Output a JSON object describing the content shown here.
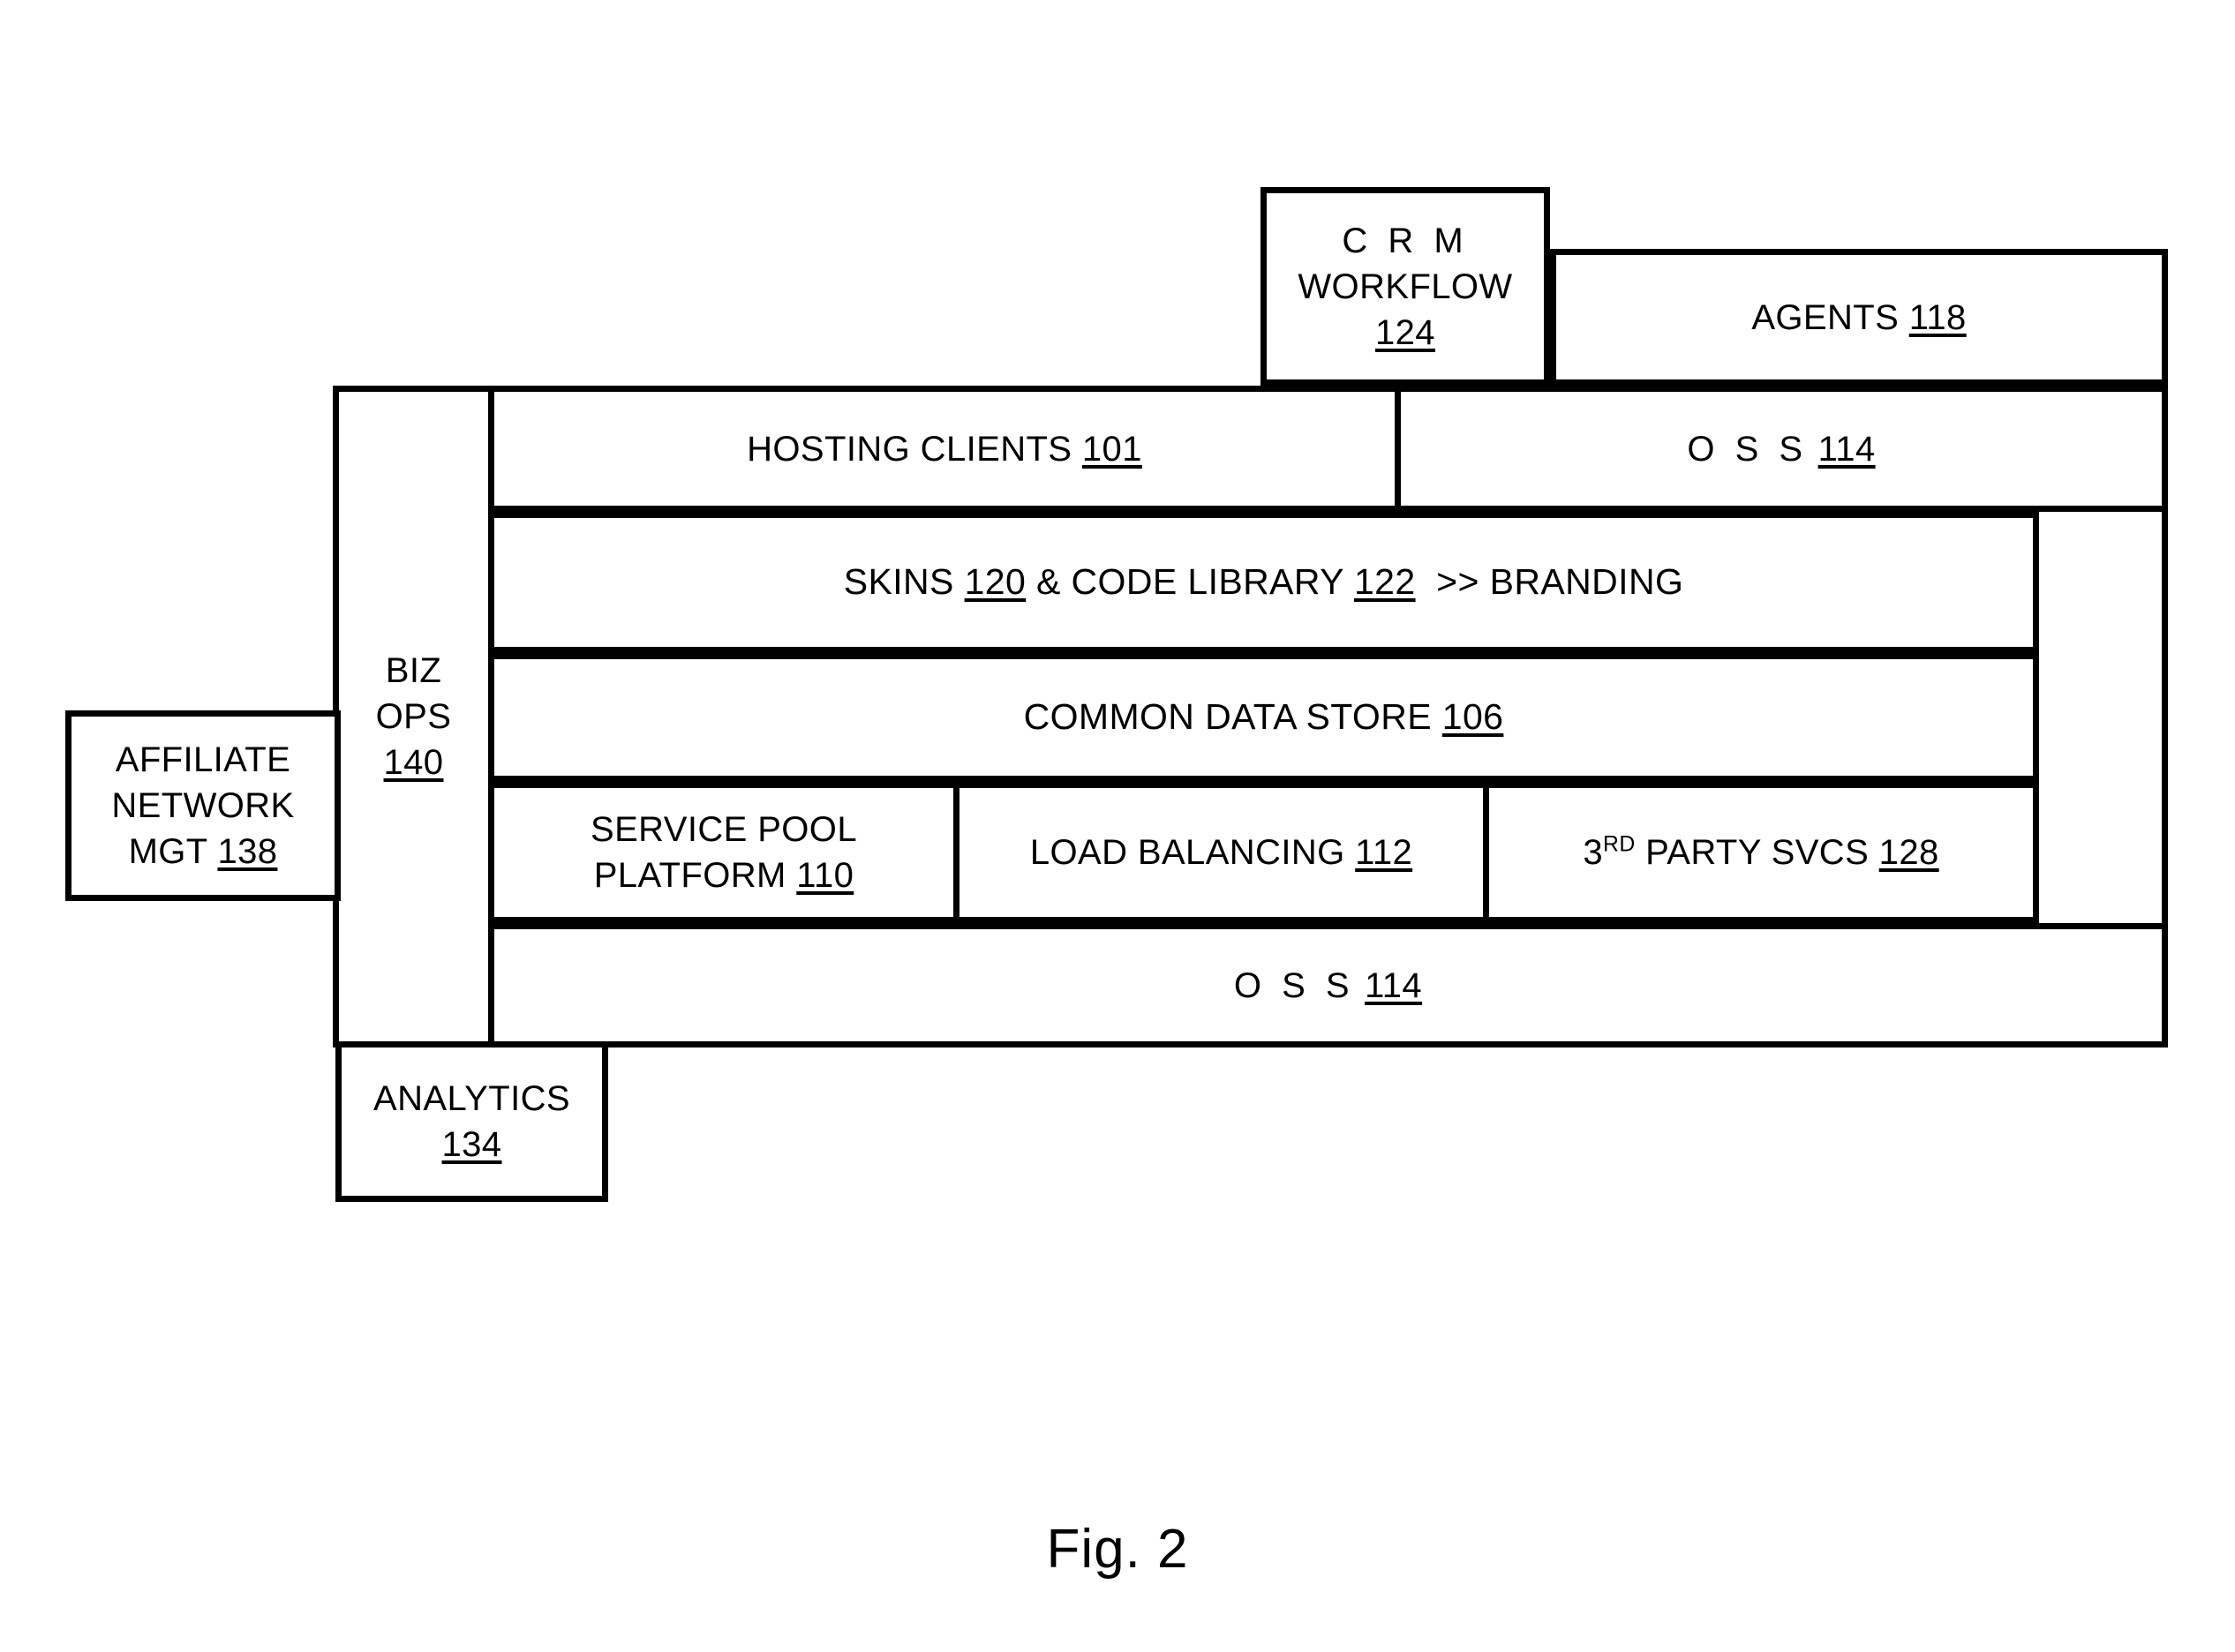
{
  "figure": {
    "caption": "Fig. 2",
    "type": "patent-block-diagram"
  },
  "blocks": {
    "crm_workflow": {
      "name": "C R M WORKFLOW",
      "line1": "C R M",
      "line2": "WORKFLOW",
      "ref": "124"
    },
    "agents": {
      "label": "AGENTS",
      "ref": "118"
    },
    "oss_top": {
      "label": "O S S",
      "ref": "114"
    },
    "hosting_clients": {
      "label": "HOSTING CLIENTS",
      "ref": "101"
    },
    "biz_ops": {
      "line1": "BIZ",
      "line2": "OPS",
      "ref": "140"
    },
    "skins": {
      "part1": "SKINS",
      "ref1": "120",
      "part2": "& CODE LIBRARY",
      "ref2": "122",
      "part3": ">> BRANDING"
    },
    "common_data_store": {
      "label": "COMMON DATA STORE",
      "ref": "106"
    },
    "service_pool": {
      "line1": "SERVICE POOL",
      "line2": "PLATFORM",
      "ref": "110"
    },
    "load_balancing": {
      "label": "LOAD BALANCING",
      "ref": "112"
    },
    "third_party_svcs": {
      "prefix": "3",
      "ordinal": "RD",
      "label": "PARTY SVCS",
      "ref": "128"
    },
    "oss_bottom": {
      "label": "O S S",
      "ref": "114"
    },
    "affiliate_network_mgt": {
      "line1": "AFFILIATE",
      "line2": "NETWORK",
      "line3": "MGT",
      "ref": "138"
    },
    "analytics": {
      "label": "ANALYTICS",
      "ref": "134"
    }
  },
  "style": {
    "stroke": "#000000",
    "fill": "#ffffff"
  }
}
